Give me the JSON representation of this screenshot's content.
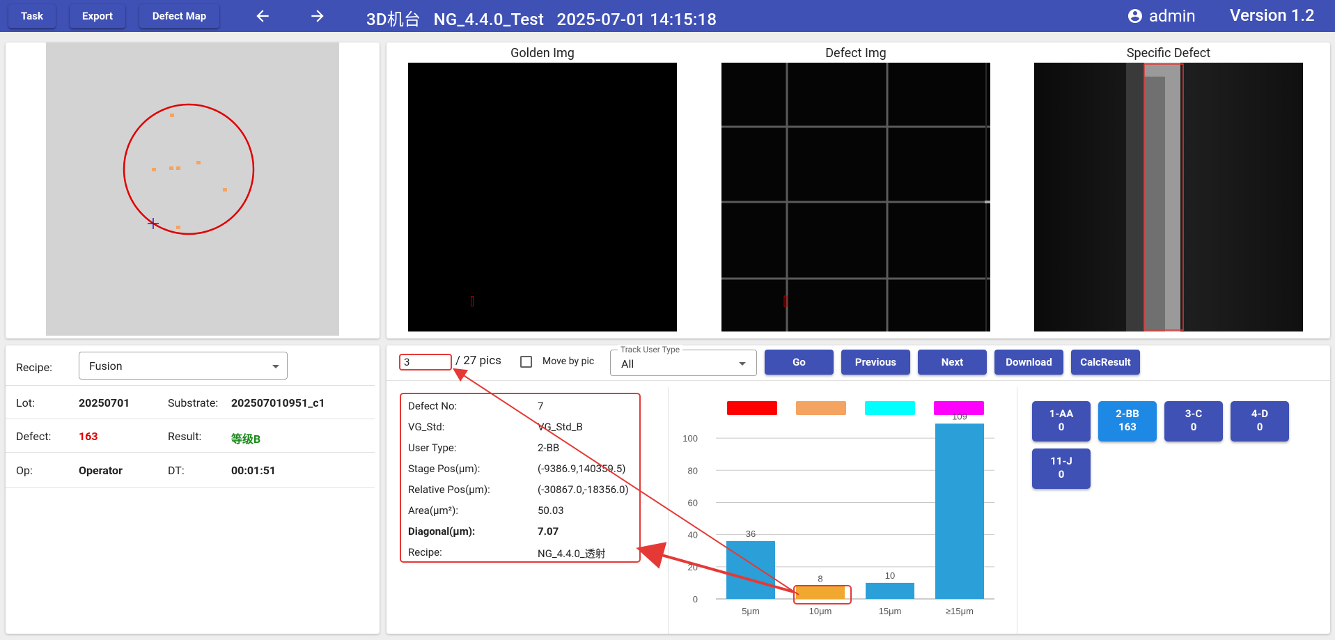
{
  "appbar": {
    "task_label": "Task",
    "export_label": "Export",
    "defect_map_label": "Defect Map",
    "title": "3D机台   NG_4.4.0_Test   2025-07-01 14:15:18",
    "user": "admin",
    "version": "Version 1.2",
    "color": "#3f51b5"
  },
  "images": {
    "golden_title": "Golden Img",
    "defect_title": "Defect Img",
    "specific_title": "Specific Defect"
  },
  "info": {
    "recipe_label": "Recipe:",
    "recipe_value": "Fusion",
    "lot_label": "Lot:",
    "lot_value": "20250701",
    "substrate_label": "Substrate:",
    "substrate_value": "202507010951_c1",
    "defect_label": "Defect:",
    "defect_value": "163",
    "result_label": "Result:",
    "result_value": "等级B",
    "op_label": "Op:",
    "op_value": "Operator",
    "dt_label": "DT:",
    "dt_value": "00:01:51"
  },
  "controls": {
    "page_input": "3",
    "total_text": "/ 27 pics",
    "move_by_pic": "Move by pic",
    "track_label": "Track User Type",
    "track_value": "All",
    "go": "Go",
    "previous": "Previous",
    "next": "Next",
    "download": "Download",
    "calc": "CalcResult"
  },
  "detail": [
    {
      "k": "Defect No:",
      "v": "7"
    },
    {
      "k": "VG_Std:",
      "v": "VG_Std_B"
    },
    {
      "k": "User Type:",
      "v": "2-BB"
    },
    {
      "k": "Stage Pos(μm):",
      "v": "(-9386.9,140359.5)"
    },
    {
      "k": "Relative Pos(μm):",
      "v": "(-30867.0,-18356.0)"
    },
    {
      "k": "Area(μm²):",
      "v": "50.03"
    },
    {
      "k": "Diagonal(μm):",
      "v": "7.07"
    },
    {
      "k": "Recipe:",
      "v": "NG_4.4.0_透射"
    }
  ],
  "chart_data": {
    "type": "bar",
    "categories": [
      "5μm",
      "10μm",
      "15μm",
      "≥15μm"
    ],
    "values": [
      36,
      8,
      10,
      109
    ],
    "ylim": [
      0,
      110
    ],
    "yticks": [
      0,
      20,
      40,
      60,
      80,
      100
    ],
    "bar_colors": [
      "#2b9fd8",
      "#f0a830",
      "#2b9fd8",
      "#2b9fd8"
    ],
    "legend_colors": [
      "#ff0000",
      "#f4a460",
      "#00ffff",
      "#ff00ff"
    ],
    "grid": true
  },
  "chips": [
    {
      "name": "1-AA",
      "count": "0"
    },
    {
      "name": "2-BB",
      "count": "163"
    },
    {
      "name": "3-C",
      "count": "0"
    },
    {
      "name": "4-D",
      "count": "0"
    },
    {
      "name": "11-J",
      "count": "0"
    }
  ],
  "annotation_color": "#e53935"
}
